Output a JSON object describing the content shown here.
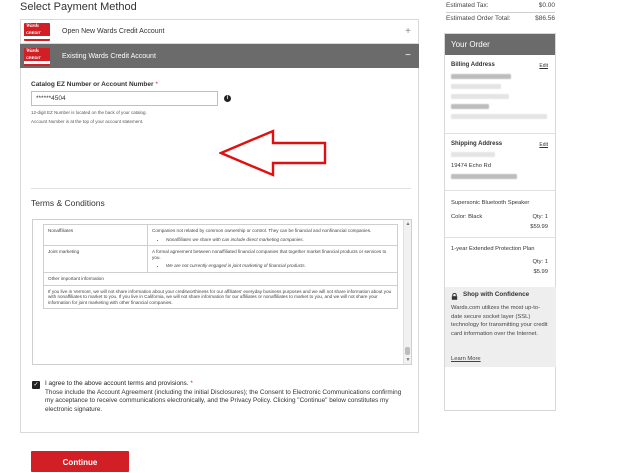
{
  "page": {
    "section_title": "Select Payment Method"
  },
  "payment_options": [
    {
      "label": "Open New Wards Credit Account",
      "icon": "plus-icon"
    },
    {
      "label": "Existing Wards Credit Account",
      "icon": "minus-icon"
    }
  ],
  "card_logo": {
    "brand": "Wards",
    "sub": "CREDIT"
  },
  "account": {
    "label": "Catalog EZ Number or Account Number",
    "required_mark": "*",
    "value": "******4504",
    "hint1": "12-digit EZ Number is located on the back of your catalog.",
    "hint2": "Account Number is at the top of your account statement."
  },
  "terms": {
    "title": "Terms & Conditions",
    "rows": [
      {
        "key": "Nonaffiliates",
        "text": "Companies not related by common ownership or control. They can be financial and nonfinancial companies.",
        "bullet": "Nonaffiliates we share with can include direct marketing companies."
      },
      {
        "key": "Joint marketing",
        "text": "A formal agreement between nonaffiliated financial companies that together market financial products or services to you.",
        "bullet": "We are not currently engaged in joint marketing of financial products."
      }
    ],
    "other_header": "Other important information",
    "vermont_text": "If you live in Vermont, we will not share information about your creditworthiness for our affiliates' everyday business purposes and we will not share information about you with nonaffiliates to market to you. If you live in California, we will not share information for our affiliates or nonaffiliates to market to you, and we will not share your information for joint marketing with other financial companies."
  },
  "agreement": {
    "lead": "I agree to the above account terms and provisions.",
    "required_mark": "*",
    "body": "Those include the Account Agreement (including the initial Disclosures); the Consent to Electronic Communications confirming my acceptance to receive communications electronically, and the Privacy Policy. Clicking \"Continue\" below constitutes my electronic signature.",
    "checked": true
  },
  "continue_label": "Continue",
  "totals": [
    {
      "label": "Estimated Tax:",
      "value": "$0.00"
    },
    {
      "label": "Estimated Order Total:",
      "value": "$86.56"
    }
  ],
  "order": {
    "title": "Your Order",
    "billing_label": "Billing Address",
    "shipping_label": "Shipping Address",
    "edit_label": "Edit",
    "shipping_street": "19474 Echo Rd",
    "items": [
      {
        "name": "Supersonic Bluetooth Speaker",
        "color": "Color: Black",
        "qty": "Qty: 1",
        "price": "$59.99"
      },
      {
        "name": "1-year Extended Protection Plan",
        "qty": "Qty: 1",
        "price": "$5.99"
      }
    ]
  },
  "shop_confidence": {
    "title": "Shop with Confidence",
    "body": "Wards.com utilizes the most up-to-date secure socket layer (SSL) technology for transmitting your credit card information over the Internet.",
    "link": "Learn More"
  },
  "colors": {
    "accent_red": "#d21f26",
    "header_gray": "#6b6b6b",
    "annotation_arrow": "#e01010"
  }
}
